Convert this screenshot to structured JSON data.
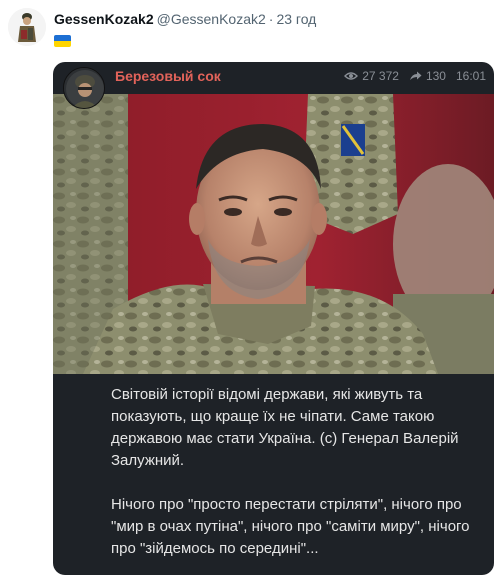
{
  "tweet": {
    "display_name": "GessenKozak2",
    "handle": "@GessenKozak2",
    "separator": "·",
    "time": "23 год",
    "flag_icon": "ukraine-flag-icon"
  },
  "embed": {
    "channel_name": "Березовый сок",
    "views": "27 372",
    "shares": "130",
    "post_time": "16:01",
    "paragraph_1": "Світовій історії відомі держави, які живуть та показують, що краще їх не чіпати. Саме такою державою має стати Україна. (с) Генерал Валерій Залужний.",
    "paragraph_2": "Нічого про \"просто перестати стріляти\", нічого про \"мир в очах путіна\", нічого про \"саміти миру\", нічого про \"зійдемось по середині\"...",
    "colors": {
      "background": "#1e2227",
      "channel_name": "#e2635a",
      "text": "#e6e6e6",
      "meta": "#8a8f96"
    }
  }
}
